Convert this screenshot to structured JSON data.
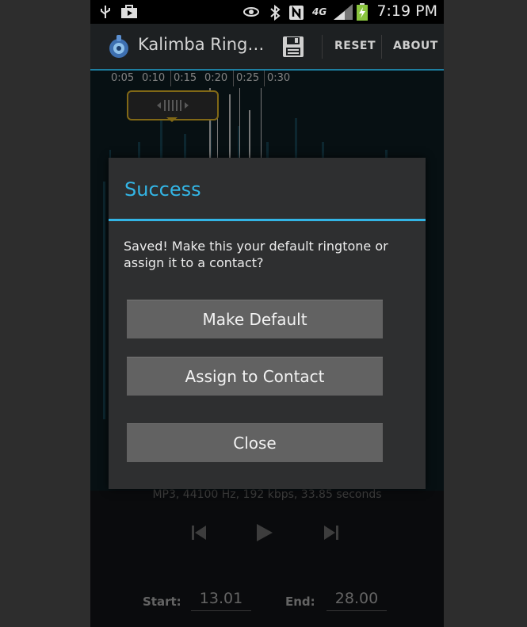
{
  "status_bar": {
    "time": "7:19 PM",
    "network": "4G",
    "icons": [
      "usb-icon",
      "shopping-bag-icon",
      "eye-icon",
      "bluetooth-icon",
      "nfc-icon",
      "signal-icon",
      "battery-charging-icon"
    ]
  },
  "action_bar": {
    "title": "Kalimba Ring…",
    "save_icon": "save-icon",
    "reset_label": "RESET",
    "about_label": "ABOUT"
  },
  "timeline": {
    "labels": [
      "0:05",
      "0:10",
      "0:15",
      "0:20",
      "0:25",
      "0:30"
    ]
  },
  "info": {
    "file_info": "MP3, 44100 Hz, 192 kbps, 33.85 seconds"
  },
  "controls": {
    "icons": [
      "skip-previous-icon",
      "play-icon",
      "skip-next-icon"
    ]
  },
  "range": {
    "start_label": "Start:",
    "start_value": "13.01",
    "end_label": "End:",
    "end_value": "28.00"
  },
  "dialog": {
    "title": "Success",
    "message": "Saved! Make this your default ringtone or assign it to a contact?",
    "make_default_label": "Make Default",
    "assign_label": "Assign to Contact",
    "close_label": "Close"
  },
  "colors": {
    "accent": "#33b5e5",
    "handle": "#c7a023",
    "button": "#626262",
    "dialog_bg": "#2e2f30"
  }
}
